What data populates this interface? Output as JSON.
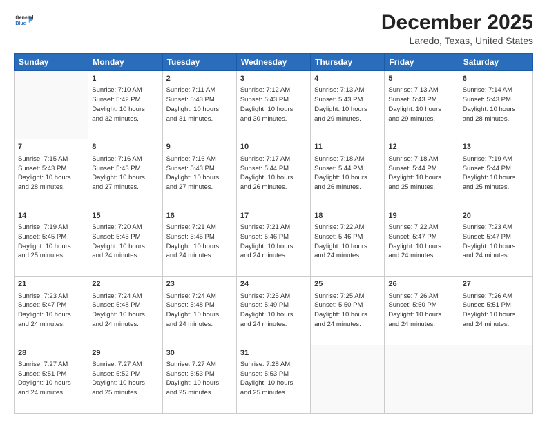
{
  "header": {
    "logo": {
      "general": "General",
      "blue": "Blue"
    },
    "title": "December 2025",
    "subtitle": "Laredo, Texas, United States"
  },
  "weekdays": [
    "Sunday",
    "Monday",
    "Tuesday",
    "Wednesday",
    "Thursday",
    "Friday",
    "Saturday"
  ],
  "weeks": [
    [
      {
        "day": "",
        "info": ""
      },
      {
        "day": "1",
        "info": "Sunrise: 7:10 AM\nSunset: 5:42 PM\nDaylight: 10 hours\nand 32 minutes."
      },
      {
        "day": "2",
        "info": "Sunrise: 7:11 AM\nSunset: 5:43 PM\nDaylight: 10 hours\nand 31 minutes."
      },
      {
        "day": "3",
        "info": "Sunrise: 7:12 AM\nSunset: 5:43 PM\nDaylight: 10 hours\nand 30 minutes."
      },
      {
        "day": "4",
        "info": "Sunrise: 7:13 AM\nSunset: 5:43 PM\nDaylight: 10 hours\nand 29 minutes."
      },
      {
        "day": "5",
        "info": "Sunrise: 7:13 AM\nSunset: 5:43 PM\nDaylight: 10 hours\nand 29 minutes."
      },
      {
        "day": "6",
        "info": "Sunrise: 7:14 AM\nSunset: 5:43 PM\nDaylight: 10 hours\nand 28 minutes."
      }
    ],
    [
      {
        "day": "7",
        "info": "Sunrise: 7:15 AM\nSunset: 5:43 PM\nDaylight: 10 hours\nand 28 minutes."
      },
      {
        "day": "8",
        "info": "Sunrise: 7:16 AM\nSunset: 5:43 PM\nDaylight: 10 hours\nand 27 minutes."
      },
      {
        "day": "9",
        "info": "Sunrise: 7:16 AM\nSunset: 5:43 PM\nDaylight: 10 hours\nand 27 minutes."
      },
      {
        "day": "10",
        "info": "Sunrise: 7:17 AM\nSunset: 5:44 PM\nDaylight: 10 hours\nand 26 minutes."
      },
      {
        "day": "11",
        "info": "Sunrise: 7:18 AM\nSunset: 5:44 PM\nDaylight: 10 hours\nand 26 minutes."
      },
      {
        "day": "12",
        "info": "Sunrise: 7:18 AM\nSunset: 5:44 PM\nDaylight: 10 hours\nand 25 minutes."
      },
      {
        "day": "13",
        "info": "Sunrise: 7:19 AM\nSunset: 5:44 PM\nDaylight: 10 hours\nand 25 minutes."
      }
    ],
    [
      {
        "day": "14",
        "info": "Sunrise: 7:19 AM\nSunset: 5:45 PM\nDaylight: 10 hours\nand 25 minutes."
      },
      {
        "day": "15",
        "info": "Sunrise: 7:20 AM\nSunset: 5:45 PM\nDaylight: 10 hours\nand 24 minutes."
      },
      {
        "day": "16",
        "info": "Sunrise: 7:21 AM\nSunset: 5:45 PM\nDaylight: 10 hours\nand 24 minutes."
      },
      {
        "day": "17",
        "info": "Sunrise: 7:21 AM\nSunset: 5:46 PM\nDaylight: 10 hours\nand 24 minutes."
      },
      {
        "day": "18",
        "info": "Sunrise: 7:22 AM\nSunset: 5:46 PM\nDaylight: 10 hours\nand 24 minutes."
      },
      {
        "day": "19",
        "info": "Sunrise: 7:22 AM\nSunset: 5:47 PM\nDaylight: 10 hours\nand 24 minutes."
      },
      {
        "day": "20",
        "info": "Sunrise: 7:23 AM\nSunset: 5:47 PM\nDaylight: 10 hours\nand 24 minutes."
      }
    ],
    [
      {
        "day": "21",
        "info": "Sunrise: 7:23 AM\nSunset: 5:47 PM\nDaylight: 10 hours\nand 24 minutes."
      },
      {
        "day": "22",
        "info": "Sunrise: 7:24 AM\nSunset: 5:48 PM\nDaylight: 10 hours\nand 24 minutes."
      },
      {
        "day": "23",
        "info": "Sunrise: 7:24 AM\nSunset: 5:48 PM\nDaylight: 10 hours\nand 24 minutes."
      },
      {
        "day": "24",
        "info": "Sunrise: 7:25 AM\nSunset: 5:49 PM\nDaylight: 10 hours\nand 24 minutes."
      },
      {
        "day": "25",
        "info": "Sunrise: 7:25 AM\nSunset: 5:50 PM\nDaylight: 10 hours\nand 24 minutes."
      },
      {
        "day": "26",
        "info": "Sunrise: 7:26 AM\nSunset: 5:50 PM\nDaylight: 10 hours\nand 24 minutes."
      },
      {
        "day": "27",
        "info": "Sunrise: 7:26 AM\nSunset: 5:51 PM\nDaylight: 10 hours\nand 24 minutes."
      }
    ],
    [
      {
        "day": "28",
        "info": "Sunrise: 7:27 AM\nSunset: 5:51 PM\nDaylight: 10 hours\nand 24 minutes."
      },
      {
        "day": "29",
        "info": "Sunrise: 7:27 AM\nSunset: 5:52 PM\nDaylight: 10 hours\nand 25 minutes."
      },
      {
        "day": "30",
        "info": "Sunrise: 7:27 AM\nSunset: 5:53 PM\nDaylight: 10 hours\nand 25 minutes."
      },
      {
        "day": "31",
        "info": "Sunrise: 7:28 AM\nSunset: 5:53 PM\nDaylight: 10 hours\nand 25 minutes."
      },
      {
        "day": "",
        "info": ""
      },
      {
        "day": "",
        "info": ""
      },
      {
        "day": "",
        "info": ""
      }
    ]
  ]
}
